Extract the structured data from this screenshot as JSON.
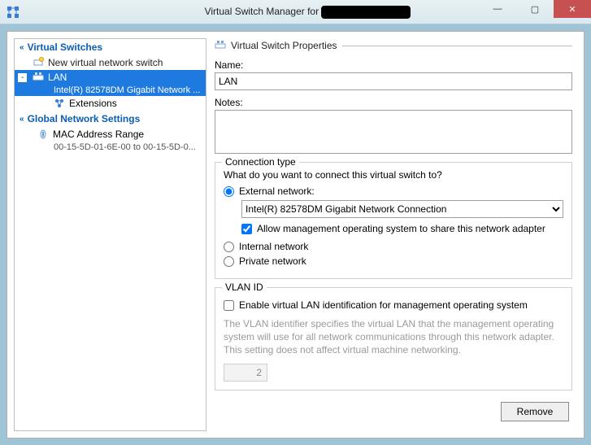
{
  "title": "Virtual Switch Manager for",
  "sidebar": {
    "virtual_switches_header": "Virtual Switches",
    "new_switch": "New virtual network switch",
    "lan": {
      "name": "LAN",
      "adapter": "Intel(R) 82578DM Gigabit Network ...",
      "extensions": "Extensions"
    },
    "global_header": "Global Network Settings",
    "mac": {
      "label": "MAC Address Range",
      "range": "00-15-5D-01-6E-00 to 00-15-5D-0..."
    }
  },
  "props": {
    "header": "Virtual Switch Properties",
    "name_label": "Name:",
    "name_value": "LAN",
    "notes_label": "Notes:",
    "notes_value": ""
  },
  "conn": {
    "legend": "Connection type",
    "question": "What do you want to connect this virtual switch to?",
    "external_label": "External network:",
    "adapter_option": "Intel(R) 82578DM Gigabit Network Connection",
    "allow_mgmt": "Allow management operating system to share this network adapter",
    "internal_label": "Internal network",
    "private_label": "Private network"
  },
  "vlan": {
    "legend": "VLAN ID",
    "enable_label": "Enable virtual LAN identification for management operating system",
    "desc": "The VLAN identifier specifies the virtual LAN that the management operating system will use for all network communications through this network adapter. This setting does not affect virtual machine networking.",
    "id_value": "2"
  },
  "buttons": {
    "remove": "Remove"
  }
}
